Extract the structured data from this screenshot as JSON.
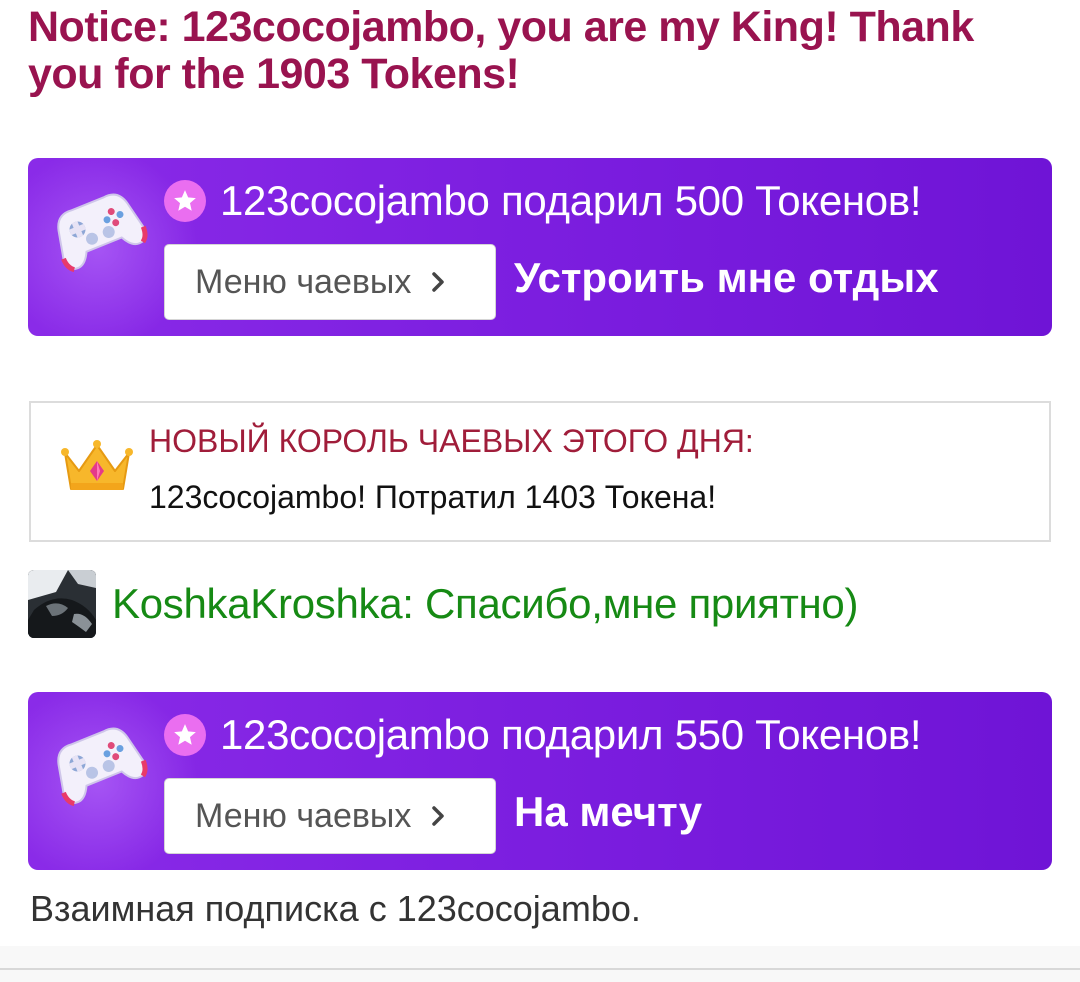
{
  "notice": {
    "text": "Notice: 123cocojambo, you are my King! Thank you for the 1903 Tokens!"
  },
  "tips": [
    {
      "text": "123cocojambo подарил 500 Токенов!",
      "menu_label": "Меню чаевых",
      "message": "Устроить мне отдых"
    },
    {
      "text": "123cocojambo подарил 550 Токенов!",
      "menu_label": "Меню чаевых",
      "message": "На мечту"
    }
  ],
  "king": {
    "title": "НОВЫЙ КОРОЛЬ ЧАЕВЫХ ЭТОГО ДНЯ:",
    "text": "123cocojambo! Потратил 1403 Токена!"
  },
  "chat": {
    "message": "KoshkaKroshka: Спасибо,мне приятно)"
  },
  "follow": {
    "text": "Взаимная подписка с 123cocojambo."
  },
  "colors": {
    "notice": "#99134f",
    "tip_card": "#7d1fe0",
    "star_badge": "#ea6ef0",
    "king_title": "#a01d3a",
    "chat_green": "#168a14"
  },
  "icons": {
    "tip_card": "gamepad-icon",
    "tip_badge": "star-icon",
    "menu_button": "chevron-right-icon",
    "king": "crown-icon",
    "chat": "avatar"
  }
}
